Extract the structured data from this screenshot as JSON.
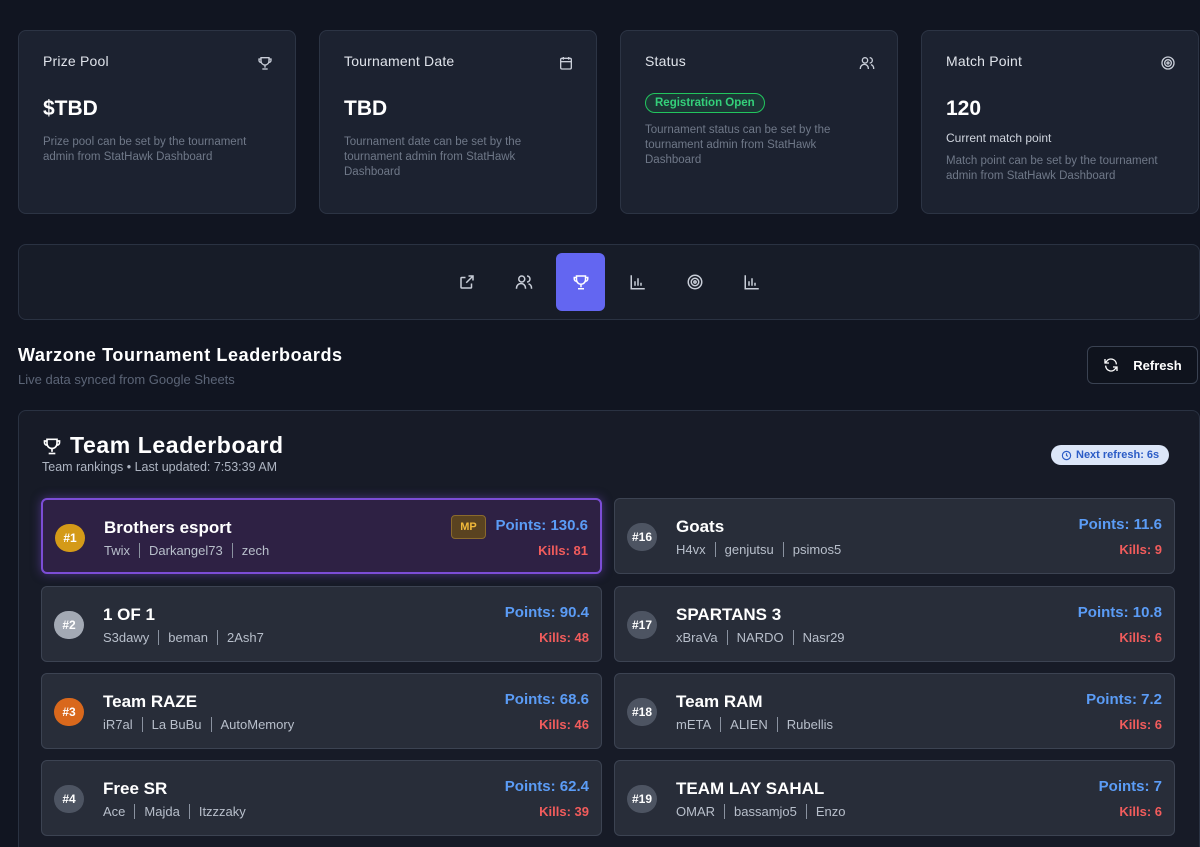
{
  "cards": [
    {
      "title": "Prize Pool",
      "icon": "trophy-icon",
      "value": "$TBD",
      "sub": "",
      "desc": "Prize pool can be set by the tournament admin from StatHawk Dashboard"
    },
    {
      "title": "Tournament Date",
      "icon": "calendar-icon",
      "value": "TBD",
      "sub": "",
      "desc": "Tournament date can be set by the tournament admin from StatHawk Dashboard"
    },
    {
      "title": "Status",
      "icon": "users-icon",
      "badge": "Registration Open",
      "desc": "Tournament status can be set by the tournament admin from StatHawk Dashboard"
    },
    {
      "title": "Match Point",
      "icon": "target-icon",
      "value": "120",
      "sub": "Current match point",
      "desc": "Match point can be set by the tournament admin from StatHawk Dashboard"
    }
  ],
  "tabs": [
    {
      "icon": "external-link-icon",
      "active": false
    },
    {
      "icon": "users-icon",
      "active": false
    },
    {
      "icon": "trophy-icon",
      "active": true
    },
    {
      "icon": "bar-chart-icon",
      "active": false
    },
    {
      "icon": "target-icon",
      "active": false
    },
    {
      "icon": "bar-chart-icon",
      "active": false
    }
  ],
  "section": {
    "title": "Warzone Tournament Leaderboards",
    "subtitle": "Live data synced from Google Sheets",
    "refresh_label": "Refresh"
  },
  "leaderboard": {
    "title": "Team Leaderboard",
    "subtitle": "Team rankings • Last updated: 7:53:39 AM",
    "next_refresh": "Next refresh: 6s",
    "teams_left": [
      {
        "rank": "#1",
        "name": "Brothers esport",
        "members": [
          "Twix",
          "Darkangel73",
          "zech"
        ],
        "points": "Points: 130.6",
        "kills": "Kills: 81",
        "mp": "MP",
        "rank_color": "#d49a18",
        "highlight": true
      },
      {
        "rank": "#2",
        "name": "1 OF 1",
        "members": [
          "S3dawy",
          "beman",
          "2Ash7"
        ],
        "points": "Points: 90.4",
        "kills": "Kills: 48",
        "rank_color": "#a3a9b4"
      },
      {
        "rank": "#3",
        "name": "Team RAZE",
        "members": [
          "iR7al",
          "La BuBu",
          "AutoMemory"
        ],
        "points": "Points: 68.6",
        "kills": "Kills: 46",
        "rank_color": "#d9681c"
      },
      {
        "rank": "#4",
        "name": "Free SR",
        "members": [
          "Ace",
          "Majda",
          "Itzzzaky"
        ],
        "points": "Points: 62.4",
        "kills": "Kills: 39",
        "rank_color": "#4d5462"
      }
    ],
    "teams_right": [
      {
        "rank": "#16",
        "name": "Goats",
        "members": [
          "H4vx",
          "genjutsu",
          "psimos5"
        ],
        "points": "Points: 11.6",
        "kills": "Kills: 9",
        "rank_color": "#4d5462"
      },
      {
        "rank": "#17",
        "name": "SPARTANS 3",
        "members": [
          "xBraVa",
          "NARDO",
          "Nasr29"
        ],
        "points": "Points: 10.8",
        "kills": "Kills: 6",
        "rank_color": "#4d5462"
      },
      {
        "rank": "#18",
        "name": "Team RAM",
        "members": [
          "mETA",
          "ALIEN",
          "Rubellis"
        ],
        "points": "Points: 7.2",
        "kills": "Kills: 6",
        "rank_color": "#4d5462"
      },
      {
        "rank": "#19",
        "name": "TEAM LAY SAHAL",
        "members": [
          "OMAR",
          "bassamjo5",
          "Enzo"
        ],
        "points": "Points: 7",
        "kills": "Kills: 6",
        "rank_color": "#4d5462"
      }
    ]
  },
  "colors": {
    "accent": "#6366f1",
    "points": "#5b9cf6",
    "kills": "#f25c5c",
    "open": "#22c55e"
  }
}
